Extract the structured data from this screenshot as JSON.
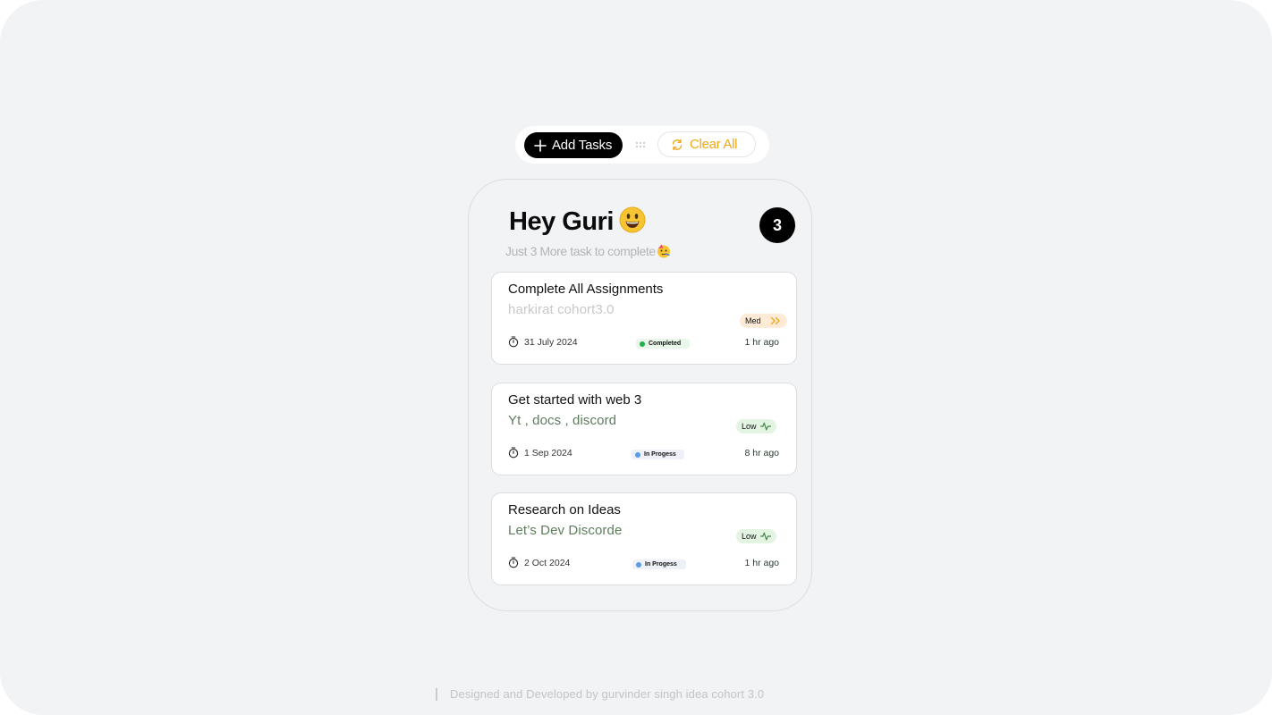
{
  "toolbar": {
    "add_label": "Add Tasks",
    "clear_label": "Clear All"
  },
  "header": {
    "greeting": "Hey Guri",
    "subtitle": "Just 3 More task to complete",
    "count": "3"
  },
  "tasks": [
    {
      "title": "Complete All Assignments",
      "subtitle": "harkirat cohort3.0",
      "priority": "Med",
      "date": "31 July 2024",
      "status": "Completed",
      "ago": "1 hr ago"
    },
    {
      "title": "Get started with web 3",
      "subtitle": "Yt , docs , discord",
      "priority": "Low",
      "date": "1 Sep 2024",
      "status": "In Progess",
      "ago": "8 hr ago"
    },
    {
      "title": "Research on Ideas",
      "subtitle": "Let’s Dev Discorde",
      "priority": "Low",
      "date": "2 Oct 2024",
      "status": "In Progess",
      "ago": "1 hr ago"
    }
  ],
  "footer": {
    "credit": "Designed and Developed  by gurvinder singh  idea cohort 3.0"
  },
  "colors": {
    "background": "#f2f3f5",
    "accent_orange": "#f0a81a",
    "completed_green": "#22b04a",
    "in_progress_blue": "#5b9be6",
    "subtitle_green": "#5d7d5c"
  },
  "icons": {
    "add": "plus-icon",
    "grip": "drag-handle-icon",
    "clear": "refresh-icon",
    "date": "stopwatch-icon",
    "med": "double-chevron-right-icon",
    "low": "activity-icon"
  }
}
